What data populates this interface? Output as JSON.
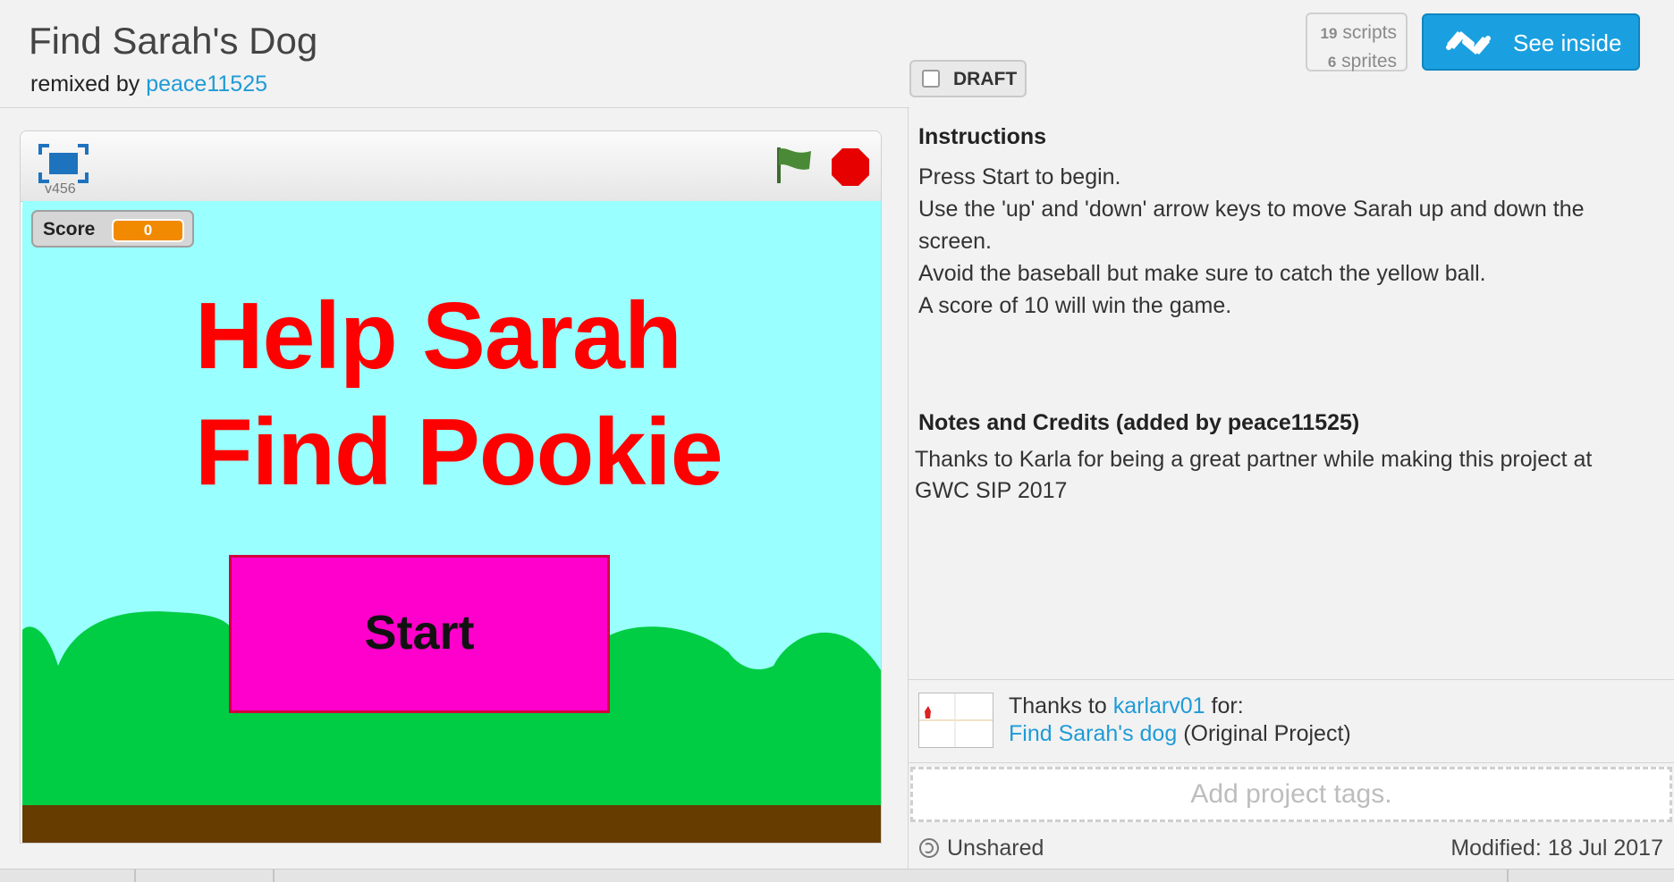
{
  "project": {
    "title": "Find Sarah's Dog",
    "remixed_prefix": "remixed by",
    "remixer": "peace11525"
  },
  "draft": {
    "label": "DRAFT",
    "checked": false
  },
  "counts": {
    "scripts_num": "19",
    "scripts_label": "scripts",
    "sprites_num": "6",
    "sprites_label": "sprites"
  },
  "see_inside": {
    "label": "See inside"
  },
  "player": {
    "version": "v456",
    "score_label": "Score",
    "score_value": "0",
    "headline_line1": "Help Sarah",
    "headline_line2": "Find Pookie",
    "start_label": "Start"
  },
  "instructions": {
    "heading": "Instructions",
    "lines": [
      "Press Start to begin.",
      "Use the 'up' and 'down' arrow keys to move Sarah up and down the screen.",
      "Avoid the baseball but make sure to catch the yellow ball.",
      "A score of 10 will win the game."
    ]
  },
  "notes": {
    "heading": "Notes and Credits (added by peace11525)",
    "text": "Thanks to Karla for being a great partner while making this project at GWC SIP 2017"
  },
  "credits": {
    "prefix": "Thanks to",
    "user": "karlarv01",
    "suffix": "for:",
    "original_title": "Find Sarah's dog",
    "original_label": "(Original Project)"
  },
  "tags": {
    "placeholder": "Add project tags."
  },
  "status": {
    "shared": "Unshared",
    "modified": "Modified: 18 Jul 2017"
  },
  "colors": {
    "accent": "#1aa0e0",
    "link": "#1f9bd6",
    "stage_bg": "#99ffff",
    "headline": "#ff0000",
    "start_bg": "#ff00cc",
    "grass": "#00cc44",
    "ground": "#663c00"
  },
  "icons": [
    "fullscreen-icon",
    "green-flag-icon",
    "stop-icon",
    "remix-arrows-icon",
    "unshared-icon"
  ]
}
